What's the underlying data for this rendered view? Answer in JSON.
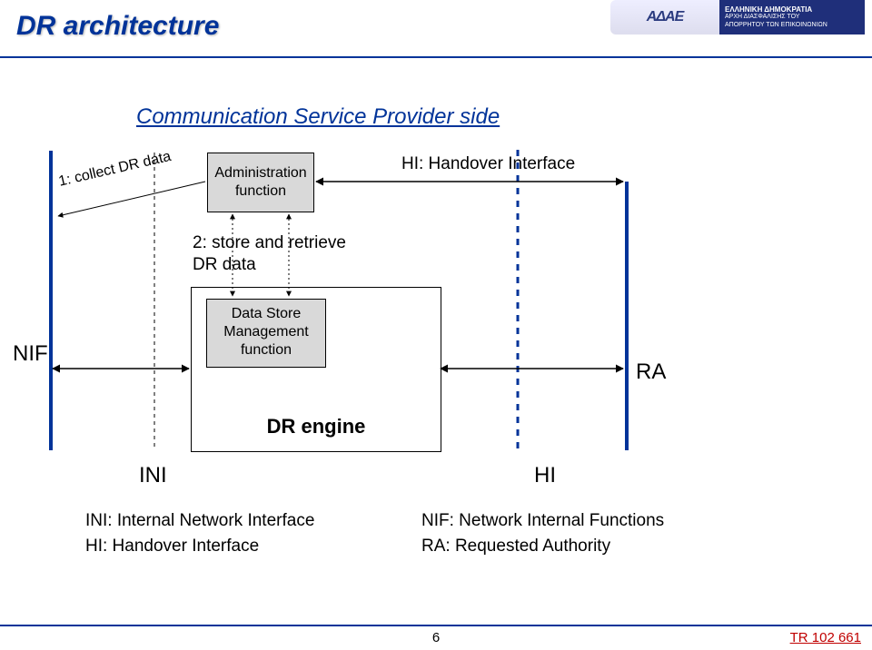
{
  "title": "DR architecture",
  "brand": {
    "acronym": "ΑΔΑE",
    "line1": "ΕΛΛΗΝΙΚΗ ΔΗΜΟΚΡΑΤΙΑ",
    "line2": "ΑΡΧΗ ΔΙΑΣΦΑΛΙΣΗΣ ΤΟΥ",
    "line3": "ΑΠΟΡΡΗΤΟΥ ΤΩΝ ΕΠΙΚΟΙΝΩΝΙΩΝ"
  },
  "diagram": {
    "csp_title": "Communication Service Provider side",
    "collect": "1: collect DR data",
    "admin_box_l1": "Administration",
    "admin_box_l2": "function",
    "store_l1": "2: store and retrieve",
    "store_l2": "DR data",
    "hi_top": "HI: Handover Interface",
    "dsm_l1": "Data Store",
    "dsm_l2": "Management",
    "dsm_l3": "function",
    "dr_engine": "DR engine",
    "nif": "NIF",
    "ini": "INI",
    "hi": "HI",
    "ra": "RA"
  },
  "legend": {
    "ini": "INI:  Internal Network Interface",
    "hi": "HI:   Handover Interface",
    "nif": "NIF: Network Internal Functions",
    "ra": "RA:  Requested Authority"
  },
  "page_number": "6",
  "doc_ref": "TR 102 661"
}
